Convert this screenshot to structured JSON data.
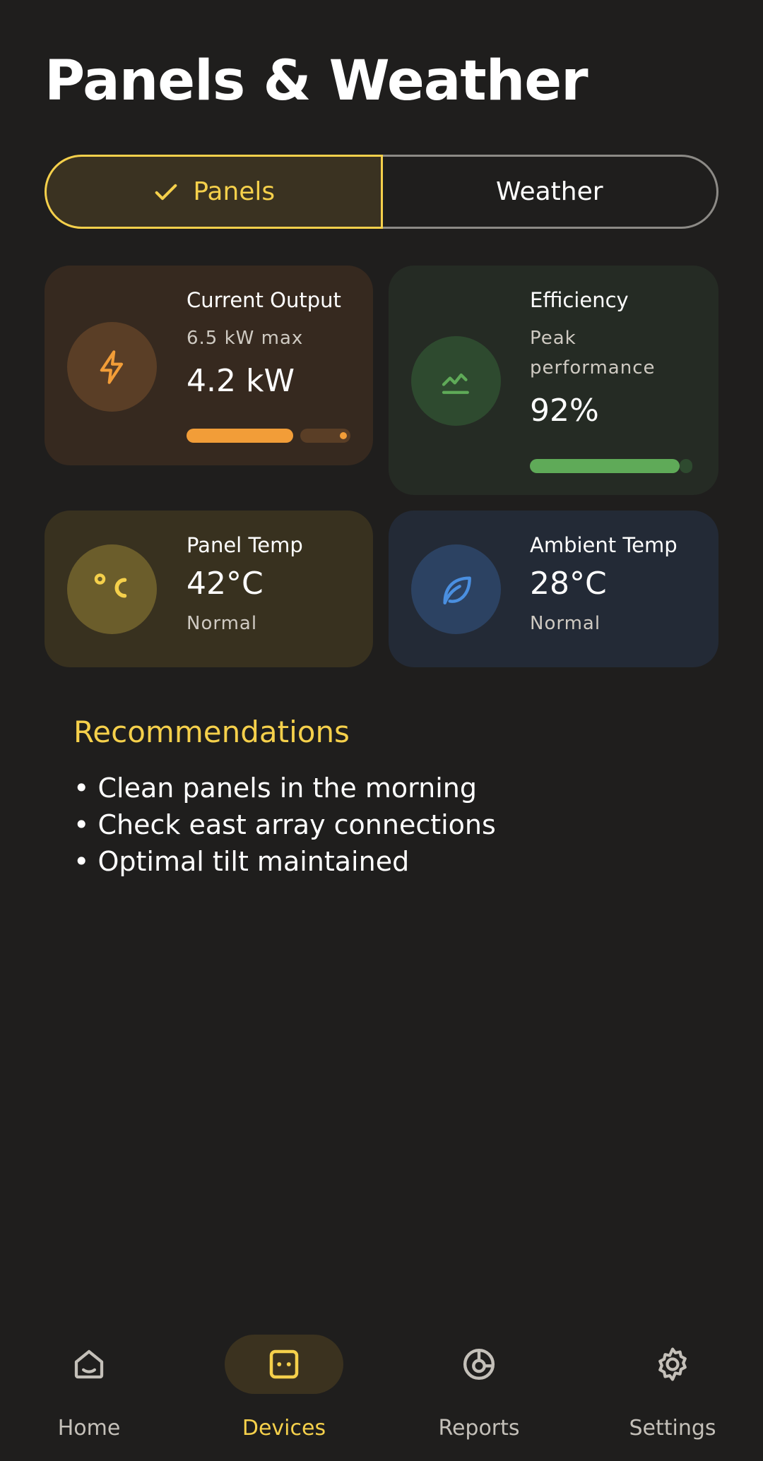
{
  "header": {
    "title": "Panels & Weather"
  },
  "segmented": {
    "panels_label": "Panels",
    "weather_label": "Weather",
    "selected": "Panels"
  },
  "cards": {
    "output": {
      "title": "Current Output",
      "sub": "6.5 kW max",
      "value": "4.2 kW",
      "progress": 0.65,
      "icon": "lightning-icon",
      "color": "#f29d38"
    },
    "efficiency": {
      "title": "Efficiency",
      "sub_line1": "Peak",
      "sub_line2": "performance",
      "value": "92%",
      "progress": 0.92,
      "icon": "trend-line-icon",
      "color": "#5faa58"
    },
    "panel_temp": {
      "title": "Panel Temp",
      "value": "42°C",
      "status": "Normal",
      "icon": "celsius-icon",
      "color": "#f5d04b"
    },
    "ambient_temp": {
      "title": "Ambient Temp",
      "value": "28°C",
      "status": "Normal",
      "icon": "leaf-icon",
      "color": "#4a8fe0"
    }
  },
  "recommendations": {
    "title": "Recommendations",
    "items": [
      "Clean panels in the morning",
      "Check east array connections",
      "Optimal tilt maintained"
    ]
  },
  "nav": {
    "items": [
      {
        "label": "Home",
        "icon": "home-icon"
      },
      {
        "label": "Devices",
        "icon": "device-icon",
        "active": true
      },
      {
        "label": "Reports",
        "icon": "reports-icon"
      },
      {
        "label": "Settings",
        "icon": "gear-icon"
      }
    ]
  },
  "colors": {
    "accent": "#f5d04b",
    "background": "#1f1e1d"
  }
}
